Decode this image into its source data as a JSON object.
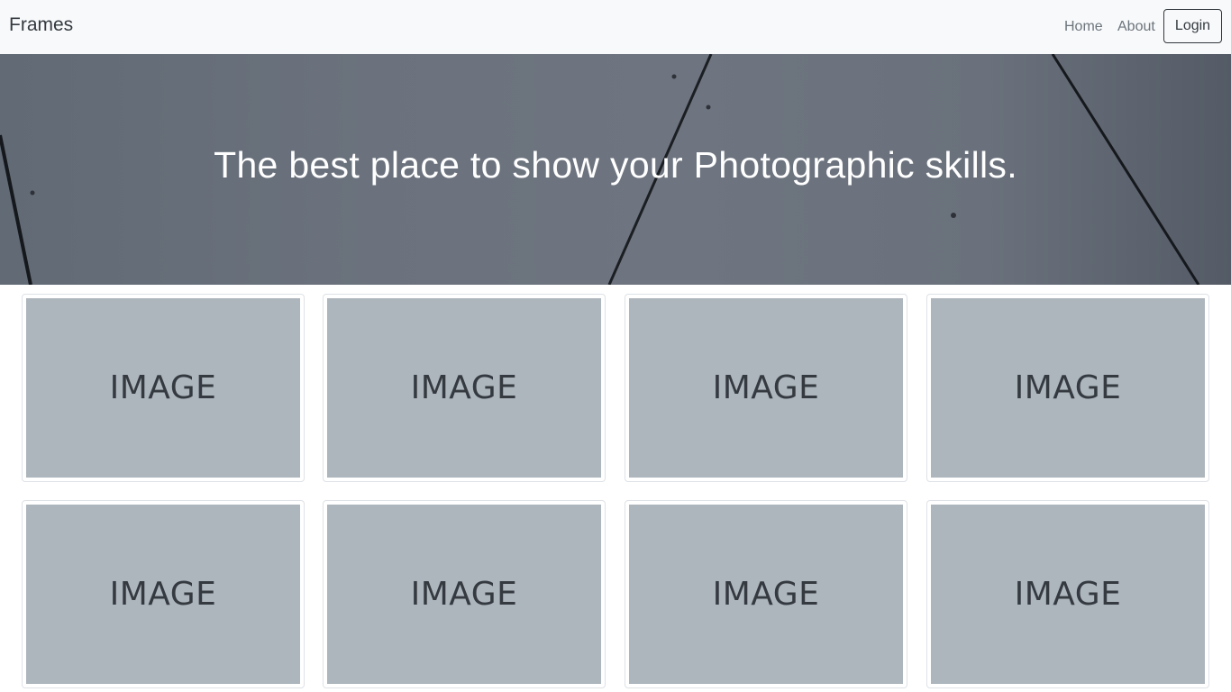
{
  "navbar": {
    "brand": "Frames",
    "links": [
      {
        "label": "Home"
      },
      {
        "label": "About"
      }
    ],
    "login_label": "Login"
  },
  "hero": {
    "title": "The best place to show your Photographic skills."
  },
  "gallery": {
    "items": [
      {
        "label": "IMAGE"
      },
      {
        "label": "IMAGE"
      },
      {
        "label": "IMAGE"
      },
      {
        "label": "IMAGE"
      },
      {
        "label": "IMAGE"
      },
      {
        "label": "IMAGE"
      },
      {
        "label": "IMAGE"
      },
      {
        "label": "IMAGE"
      }
    ]
  },
  "colors": {
    "navbar_bg": "#f8f9fa",
    "hero_bg": "#6b727d",
    "placeholder_bg": "#adb5bd",
    "placeholder_text": "#343a40"
  }
}
